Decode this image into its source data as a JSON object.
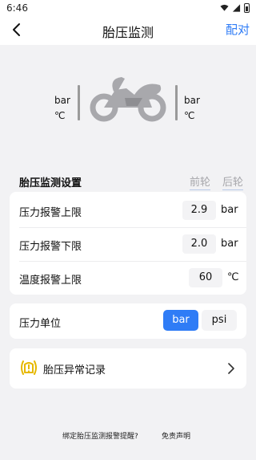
{
  "status_bar": {
    "time": "6:46"
  },
  "nav": {
    "title": "胎压监测",
    "pair_label": "配对"
  },
  "hero": {
    "left_pressure_unit": "bar",
    "left_temp_unit": "℃",
    "right_pressure_unit": "bar",
    "right_temp_unit": "℃",
    "icon": "motorcycle-icon"
  },
  "settings": {
    "title": "胎压监测设置",
    "tabs": [
      "前轮",
      "后轮"
    ],
    "rows": [
      {
        "label": "压力报警上限",
        "value": "2.9",
        "unit": "bar"
      },
      {
        "label": "压力报警下限",
        "value": "2.0",
        "unit": "bar"
      },
      {
        "label": "温度报警上限",
        "value": "60",
        "unit": "℃"
      }
    ]
  },
  "pressure_unit": {
    "label": "压力单位",
    "options": [
      "bar",
      "psi"
    ],
    "selected": "bar"
  },
  "record": {
    "label": "胎压异常记录",
    "icon": "tire-warning-icon"
  },
  "footer": {
    "link1": "绑定胎压监测报警提醒?",
    "link2": "免责声明"
  },
  "colors": {
    "accent": "#2f7cf6",
    "warning": "#e6b800",
    "background": "#f2f2f4"
  }
}
